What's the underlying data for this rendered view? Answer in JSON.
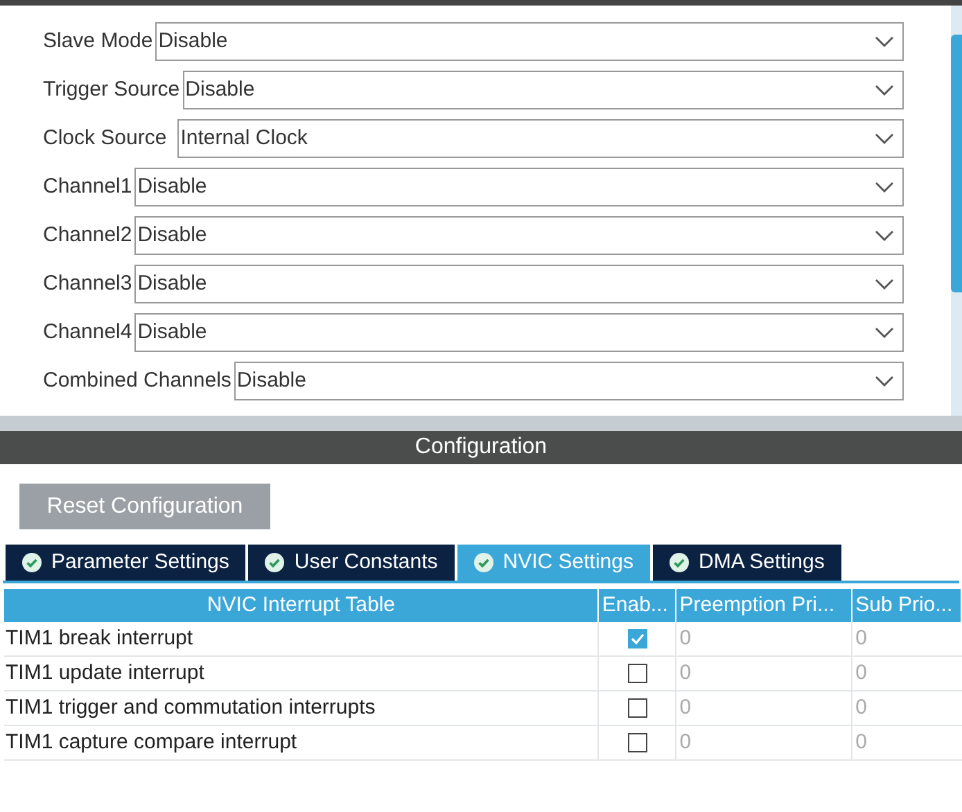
{
  "fields": [
    {
      "label": "Slave Mode",
      "value": "Disable"
    },
    {
      "label": "Trigger Source",
      "value": "Disable"
    },
    {
      "label": "Clock Source",
      "value": "Internal Clock"
    },
    {
      "label": "Channel1",
      "value": "Disable"
    },
    {
      "label": "Channel2",
      "value": "Disable"
    },
    {
      "label": "Channel3",
      "value": "Disable"
    },
    {
      "label": "Channel4",
      "value": "Disable"
    },
    {
      "label": "Combined Channels",
      "value": "Disable"
    }
  ],
  "configuration": {
    "title": "Configuration",
    "reset_button": "Reset Configuration",
    "tabs": [
      {
        "label": "Parameter Settings",
        "selected": false
      },
      {
        "label": "User Constants",
        "selected": false
      },
      {
        "label": "NVIC Settings",
        "selected": true
      },
      {
        "label": "DMA Settings",
        "selected": false
      }
    ],
    "table": {
      "columns": [
        "NVIC Interrupt Table",
        "Enab...",
        "Preemption Pri...",
        "Sub Prio..."
      ],
      "rows": [
        {
          "name": "TIM1 break interrupt",
          "enabled": true,
          "preemption": "0",
          "sub": "0"
        },
        {
          "name": "TIM1 update interrupt",
          "enabled": false,
          "preemption": "0",
          "sub": "0"
        },
        {
          "name": "TIM1 trigger and commutation interrupts",
          "enabled": false,
          "preemption": "0",
          "sub": "0"
        },
        {
          "name": "TIM1 capture compare interrupt",
          "enabled": false,
          "preemption": "0",
          "sub": "0"
        }
      ]
    }
  }
}
